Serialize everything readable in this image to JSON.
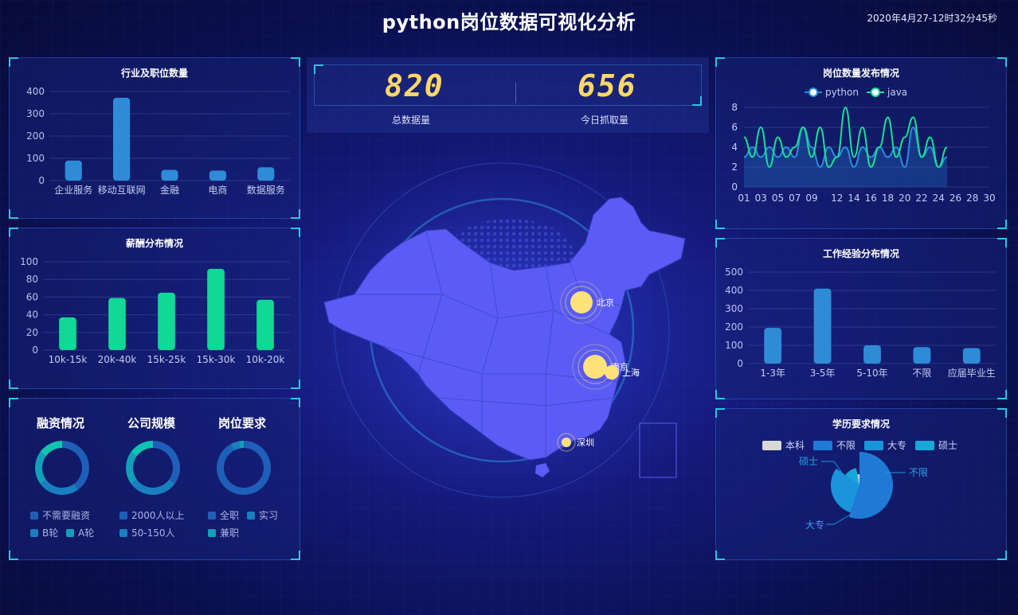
{
  "header": {
    "title": "python岗位数据可视化分析",
    "datetime": "2020年4月27-12时32分45秒"
  },
  "stats": {
    "total_value": "820",
    "total_label": "总数据量",
    "today_value": "656",
    "today_label": "今日抓取量"
  },
  "industry": {
    "title": "行业及职位数量",
    "chart_data": {
      "type": "bar",
      "categories": [
        "企业服务",
        "移动互联网",
        "金融",
        "电商",
        "数据服务"
      ],
      "values": [
        90,
        372,
        48,
        45,
        60
      ],
      "ylim": [
        0,
        400
      ],
      "yticks": [
        "0",
        "100",
        "200",
        "300",
        "400"
      ],
      "color": "#2e8cd6"
    }
  },
  "salary": {
    "title": "薪酬分布情况",
    "chart_data": {
      "type": "bar",
      "categories": [
        "10k-15k",
        "20k-40k",
        "15k-25k",
        "15k-30k",
        "10k-20k"
      ],
      "values": [
        37,
        59,
        65,
        92,
        57
      ],
      "ylim": [
        0,
        100
      ],
      "yticks": [
        "0",
        "20",
        "40",
        "60",
        "80",
        "100"
      ],
      "color": "#10d895"
    }
  },
  "donuts": [
    {
      "title": "融资情况",
      "legend": [
        "不需要融资",
        "B轮",
        "A轮"
      ],
      "chart_data": {
        "type": "pie",
        "values": [
          40,
          25,
          20,
          15
        ]
      }
    },
    {
      "title": "公司规模",
      "legend": [
        "2000人以上",
        "50-150人"
      ],
      "chart_data": {
        "type": "pie",
        "values": [
          35,
          30,
          20,
          15
        ]
      }
    },
    {
      "title": "岗位要求",
      "legend": [
        "全职",
        "实习",
        "兼职"
      ],
      "chart_data": {
        "type": "pie",
        "values": [
          92,
          5,
          3
        ]
      }
    }
  ],
  "trend": {
    "title": "岗位数量发布情况",
    "legend": [
      "python",
      "java"
    ],
    "chart_data": {
      "type": "line",
      "x": [
        "01",
        "02",
        "03",
        "04",
        "05",
        "06",
        "07",
        "08",
        "09",
        "10",
        "11",
        "12",
        "13",
        "14",
        "15",
        "16",
        "17",
        "18",
        "19",
        "20",
        "21",
        "22",
        "23",
        "24",
        "25"
      ],
      "xticks": [
        "01",
        "03",
        "05",
        "07",
        "09",
        "12",
        "14",
        "16",
        "18",
        "20",
        "22",
        "24",
        "26",
        "28",
        "30"
      ],
      "ylim": [
        0,
        8
      ],
      "yticks": [
        "0",
        "2",
        "4",
        "6",
        "8"
      ],
      "series": [
        {
          "name": "python",
          "values": [
            3,
            4,
            3,
            4,
            3,
            4,
            3,
            6,
            4,
            2,
            4,
            3,
            4,
            2,
            4,
            3,
            4,
            3,
            4,
            2,
            6,
            3,
            4,
            2,
            3
          ]
        },
        {
          "name": "java",
          "values": [
            5,
            3,
            6,
            2,
            5,
            3,
            4,
            6,
            3,
            6,
            2,
            3,
            8,
            3,
            6,
            2,
            4,
            7,
            3,
            5,
            7,
            3,
            5,
            2,
            4
          ]
        }
      ],
      "colors": [
        "#2a8ee0",
        "#15e28f"
      ]
    }
  },
  "experience": {
    "title": "工作经验分布情况",
    "chart_data": {
      "type": "bar",
      "categories": [
        "1-3年",
        "3-5年",
        "5-10年",
        "不限",
        "应届毕业生"
      ],
      "values": [
        195,
        410,
        100,
        90,
        85
      ],
      "ylim": [
        0,
        500
      ],
      "yticks": [
        "0",
        "100",
        "200",
        "300",
        "400",
        "500"
      ],
      "color": "#2e8cd6"
    }
  },
  "education": {
    "title": "学历要求情况",
    "legend": [
      "本科",
      "不限",
      "大专",
      "硕士"
    ],
    "chart_data": {
      "type": "pie",
      "categories": [
        "不限",
        "大专",
        "硕士",
        "本科"
      ],
      "values": [
        55,
        30,
        12,
        3
      ],
      "colors": [
        "#1f7ad6",
        "#1a95dc",
        "#18a8d8",
        "#d8d8d8"
      ]
    },
    "labels": {
      "a": "不限",
      "b": "大专",
      "c": "硕士"
    }
  },
  "map": {
    "cities": [
      "北京",
      "南京",
      "上海",
      "深圳"
    ]
  }
}
